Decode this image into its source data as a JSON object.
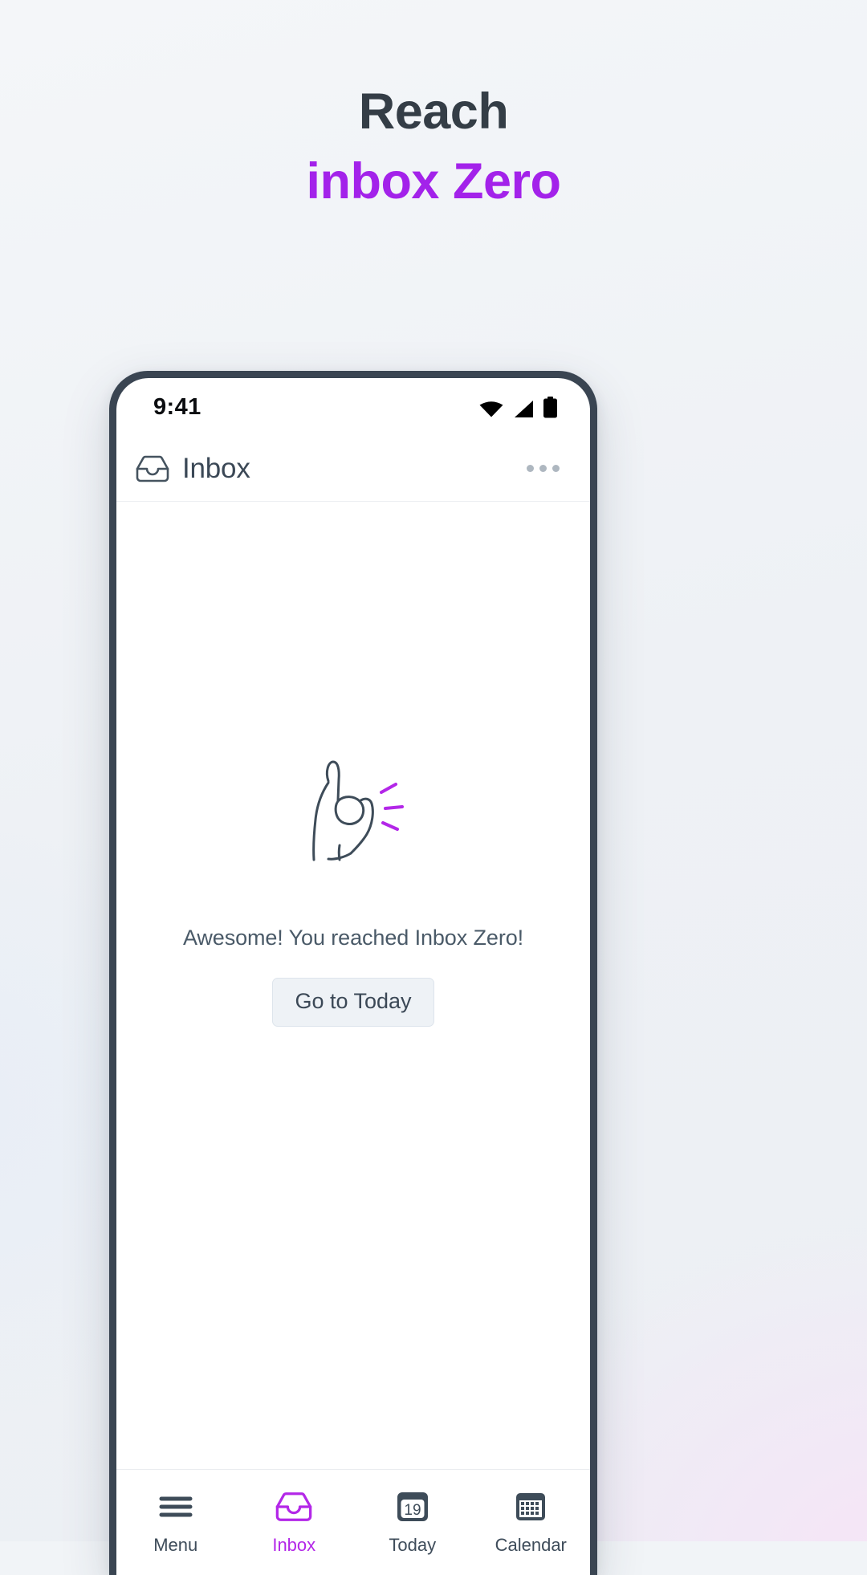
{
  "page": {
    "background_color": "#f1f4f7",
    "accent_color": "#a322ea",
    "ink_color": "#3a4552"
  },
  "hero": {
    "line1": "Reach",
    "line2": "inbox Zero"
  },
  "phone": {
    "status_bar": {
      "time": "9:41",
      "icons": [
        "wifi-icon",
        "cellular-signal-icon",
        "battery-icon"
      ]
    },
    "app_bar": {
      "icon": "inbox-tray-icon",
      "title": "Inbox",
      "overflow_menu": "kebab-menu-icon"
    },
    "empty_state": {
      "illustration": "ok-hand-icon",
      "message": "Awesome! You reached Inbox Zero!",
      "button_label": "Go to Today"
    },
    "bottom_nav": {
      "active_index": 1,
      "items": [
        {
          "label": "Menu",
          "icon": "hamburger-menu-icon"
        },
        {
          "label": "Inbox",
          "icon": "inbox-tray-icon"
        },
        {
          "label": "Today",
          "icon": "calendar-day-icon",
          "badge": "19"
        },
        {
          "label": "Calendar",
          "icon": "calendar-grid-icon"
        }
      ]
    }
  }
}
